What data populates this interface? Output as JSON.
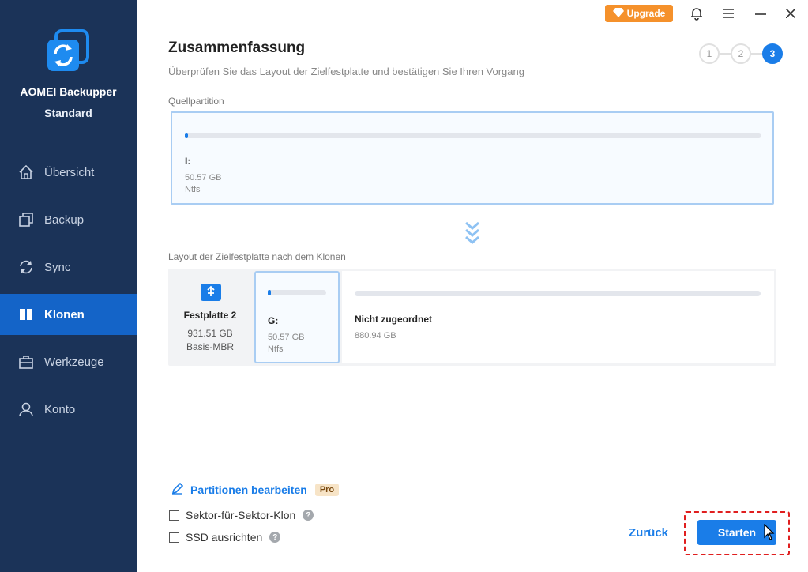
{
  "sidebar": {
    "app_name": "AOMEI Backupper",
    "edition": "Standard",
    "items": [
      {
        "label": "Übersicht",
        "icon": "home-icon"
      },
      {
        "label": "Backup",
        "icon": "backup-icon"
      },
      {
        "label": "Sync",
        "icon": "sync-icon"
      },
      {
        "label": "Klonen",
        "icon": "clone-icon",
        "active": true
      },
      {
        "label": "Werkzeuge",
        "icon": "toolbox-icon"
      },
      {
        "label": "Konto",
        "icon": "user-icon"
      }
    ]
  },
  "topbar": {
    "upgrade_label": "Upgrade",
    "icons": [
      "bell-icon",
      "menu-icon",
      "minimize-icon",
      "close-icon"
    ]
  },
  "header": {
    "title": "Zusammenfassung",
    "subtitle": "Überprüfen Sie das Layout der Zielfestplatte und bestätigen Sie Ihren Vorgang",
    "steps": [
      "1",
      "2",
      "3"
    ],
    "active_step": 3
  },
  "source": {
    "label": "Quellpartition",
    "partition": {
      "letter": "I:",
      "size": "50.57 GB",
      "fs": "Ntfs"
    }
  },
  "destination": {
    "label": "Layout der Zielfestplatte nach dem Klonen",
    "disk": {
      "name": "Festplatte 2",
      "size": "931.51 GB",
      "type": "Basis-MBR"
    },
    "partition": {
      "letter": "G:",
      "size": "50.57 GB",
      "fs": "Ntfs"
    },
    "unallocated": {
      "label": "Nicht zugeordnet",
      "size": "880.94 GB"
    }
  },
  "options": {
    "edit_partitions": "Partitionen bearbeiten",
    "pro_badge": "Pro",
    "sector_clone": "Sektor-für-Sektor-Klon",
    "ssd_align": "SSD ausrichten"
  },
  "actions": {
    "back": "Zurück",
    "start": "Starten"
  },
  "colors": {
    "sidebar_bg": "#1b3358",
    "accent": "#1a7de8",
    "upgrade": "#f5912b"
  }
}
